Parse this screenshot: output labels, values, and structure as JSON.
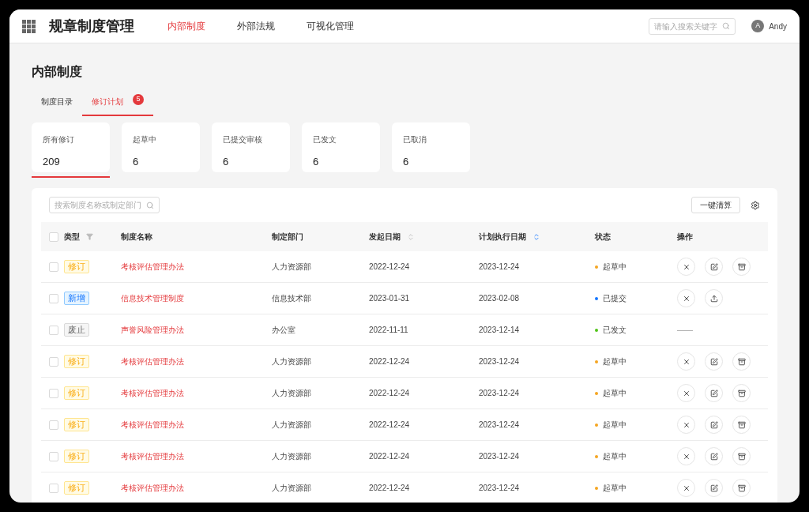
{
  "app": {
    "title": "规章制度管理"
  },
  "nav": [
    {
      "label": "内部制度",
      "selected": true
    },
    {
      "label": "外部法规",
      "selected": false
    },
    {
      "label": "可视化管理",
      "selected": false
    }
  ],
  "header_search": {
    "placeholder": "请输入搜索关键字"
  },
  "user": {
    "initial": "A",
    "name": "Andy"
  },
  "page_title": "内部制度",
  "tabs": [
    {
      "label": "制度目录",
      "selected": false
    },
    {
      "label": "修订计划",
      "selected": true,
      "badge": "5"
    }
  ],
  "stats": [
    {
      "label": "所有修订",
      "value": "209",
      "selected": true
    },
    {
      "label": "起草中",
      "value": "6",
      "selected": false
    },
    {
      "label": "已提交审核",
      "value": "6",
      "selected": false
    },
    {
      "label": "已发文",
      "value": "6",
      "selected": false
    },
    {
      "label": "已取消",
      "value": "6",
      "selected": false
    }
  ],
  "table_search": {
    "placeholder": "搜索制度名称或制定部门"
  },
  "clear_button": "一键清算",
  "table": {
    "select_all_checked": false,
    "columns": [
      {
        "label": "类型",
        "kind": "filter"
      },
      {
        "label": "制度名称",
        "kind": "plain"
      },
      {
        "label": "制定部门",
        "kind": "plain"
      },
      {
        "label": "发起日期",
        "kind": "sort"
      },
      {
        "label": "计划执行日期",
        "kind": "sort_asc"
      },
      {
        "label": "状态",
        "kind": "plain"
      },
      {
        "label": "操作",
        "kind": "plain"
      }
    ],
    "rows": [
      {
        "checked": false,
        "type": {
          "label": "修订",
          "kind": "revise"
        },
        "name": "考核评估管理办法",
        "dept": "人力资源部",
        "start": "2022-12-24",
        "plan": "2023-12-24",
        "status": {
          "label": "起草中",
          "color": "#f5a623"
        },
        "actions": [
          {
            "kind": "cancel"
          },
          {
            "kind": "edit"
          },
          {
            "kind": "archive"
          }
        ]
      },
      {
        "checked": false,
        "type": {
          "label": "新增",
          "kind": "new"
        },
        "name": "信息技术管理制度",
        "dept": "信息技术部",
        "start": "2023-01-31",
        "plan": "2023-02-08",
        "status": {
          "label": "已提交",
          "color": "#1677ff"
        },
        "actions": [
          {
            "kind": "cancel"
          },
          {
            "kind": "upload"
          }
        ]
      },
      {
        "checked": false,
        "type": {
          "label": "废止",
          "kind": "abolish"
        },
        "name": "声誉风险管理办法",
        "dept": "办公室",
        "start": "2022-11-11",
        "plan": "2023-12-14",
        "status": {
          "label": "已发文",
          "color": "#52c41a"
        },
        "no_actions_text": "——"
      },
      {
        "checked": false,
        "type": {
          "label": "修订",
          "kind": "revise"
        },
        "name": "考核评估管理办法",
        "dept": "人力资源部",
        "start": "2022-12-24",
        "plan": "2023-12-24",
        "status": {
          "label": "起草中",
          "color": "#f5a623"
        },
        "actions": [
          {
            "kind": "cancel"
          },
          {
            "kind": "edit"
          },
          {
            "kind": "archive"
          }
        ]
      },
      {
        "checked": false,
        "type": {
          "label": "修订",
          "kind": "revise"
        },
        "name": "考核评估管理办法",
        "dept": "人力资源部",
        "start": "2022-12-24",
        "plan": "2023-12-24",
        "status": {
          "label": "起草中",
          "color": "#f5a623"
        },
        "actions": [
          {
            "kind": "cancel"
          },
          {
            "kind": "edit"
          },
          {
            "kind": "archive"
          }
        ]
      },
      {
        "checked": false,
        "type": {
          "label": "修订",
          "kind": "revise"
        },
        "name": "考核评估管理办法",
        "dept": "人力资源部",
        "start": "2022-12-24",
        "plan": "2023-12-24",
        "status": {
          "label": "起草中",
          "color": "#f5a623"
        },
        "actions": [
          {
            "kind": "cancel"
          },
          {
            "kind": "edit"
          },
          {
            "kind": "archive"
          }
        ]
      },
      {
        "checked": false,
        "type": {
          "label": "修订",
          "kind": "revise"
        },
        "name": "考核评估管理办法",
        "dept": "人力资源部",
        "start": "2022-12-24",
        "plan": "2023-12-24",
        "status": {
          "label": "起草中",
          "color": "#f5a623"
        },
        "actions": [
          {
            "kind": "cancel"
          },
          {
            "kind": "edit"
          },
          {
            "kind": "archive"
          }
        ]
      },
      {
        "checked": false,
        "type": {
          "label": "修订",
          "kind": "revise"
        },
        "name": "考核评估管理办法",
        "dept": "人力资源部",
        "start": "2022-12-24",
        "plan": "2023-12-24",
        "status": {
          "label": "起草中",
          "color": "#f5a623"
        },
        "actions": [
          {
            "kind": "cancel"
          },
          {
            "kind": "edit"
          },
          {
            "kind": "archive"
          }
        ]
      }
    ]
  }
}
